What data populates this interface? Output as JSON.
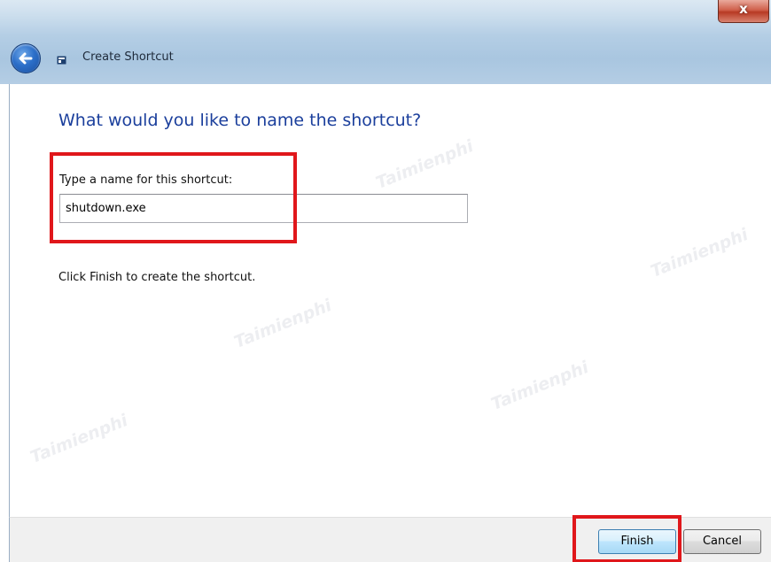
{
  "window": {
    "title": "Create Shortcut",
    "close_glyph": "x"
  },
  "wizard": {
    "heading": "What would you like to name the shortcut?",
    "field_label": "Type a name for this shortcut:",
    "name_value": "shutdown.exe",
    "hint": "Click Finish to create the shortcut."
  },
  "buttons": {
    "finish": "Finish",
    "cancel": "Cancel"
  },
  "icons": {
    "back": "back-arrow-icon",
    "wizard": "shortcut-wizard-icon",
    "close": "close-icon"
  },
  "colors": {
    "heading": "#1b3f9c",
    "highlight": "#e0171b"
  },
  "watermark": {
    "text": "Taimienphi"
  }
}
